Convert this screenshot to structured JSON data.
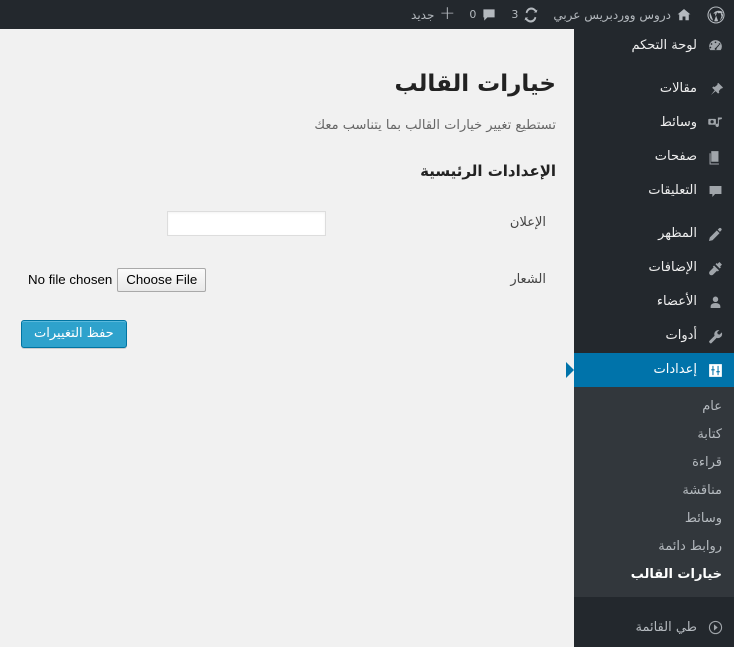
{
  "adminbar": {
    "site_name": "دروس ووردبريس عربي",
    "updates_count": "3",
    "comments_count": "0",
    "new_label": "جديد",
    "wp_logo_icon": "wordpress-icon",
    "home_icon": "home-icon",
    "updates_icon": "updates-icon",
    "comments_icon": "comment-bubble-icon",
    "new_icon": "plus-icon"
  },
  "sidebar": {
    "items": [
      {
        "label": "لوحة التحكم",
        "icon": "dashboard-icon",
        "name": "dashboard"
      },
      {
        "label": "مقالات",
        "icon": "pin-icon",
        "name": "posts"
      },
      {
        "label": "وسائط",
        "icon": "media-icon",
        "name": "media"
      },
      {
        "label": "صفحات",
        "icon": "pages-icon",
        "name": "pages"
      },
      {
        "label": "التعليقات",
        "icon": "comment-bubble-icon",
        "name": "comments"
      },
      {
        "label": "المظهر",
        "icon": "paintbrush-icon",
        "name": "appearance"
      },
      {
        "label": "الإضافات",
        "icon": "plug-icon",
        "name": "plugins"
      },
      {
        "label": "الأعضاء",
        "icon": "user-icon",
        "name": "users"
      },
      {
        "label": "أدوات",
        "icon": "wrench-icon",
        "name": "tools"
      },
      {
        "label": "إعدادات",
        "icon": "settings-sliders-icon",
        "name": "settings"
      }
    ],
    "submenu": [
      {
        "label": "عام",
        "name": "general"
      },
      {
        "label": "كتابة",
        "name": "writing"
      },
      {
        "label": "قراءة",
        "name": "reading"
      },
      {
        "label": "مناقشة",
        "name": "discussion"
      },
      {
        "label": "وسائط",
        "name": "media"
      },
      {
        "label": "روابط دائمة",
        "name": "permalinks"
      },
      {
        "label": "خيارات القالب",
        "name": "theme-options"
      }
    ],
    "collapse_label": "طي القائمة",
    "collapse_icon": "collapse-arrow-icon",
    "active_color": "#0073aa",
    "background": "#23282d",
    "submenu_background": "#32373c"
  },
  "main": {
    "page_title": "خيارات القالب",
    "page_description": "تستطيع تغيير خيارات القالب بما يتناسب معك",
    "section_title": "الإعدادات الرئيسية",
    "fields": [
      {
        "label": "الإعلان",
        "type": "text",
        "value": "",
        "placeholder": ""
      },
      {
        "label": "الشعار",
        "type": "file",
        "button_label": "Choose File",
        "status": "No file chosen"
      }
    ],
    "submit_label": "حفظ التغييرات",
    "primary_color": "#2ea2cc"
  }
}
